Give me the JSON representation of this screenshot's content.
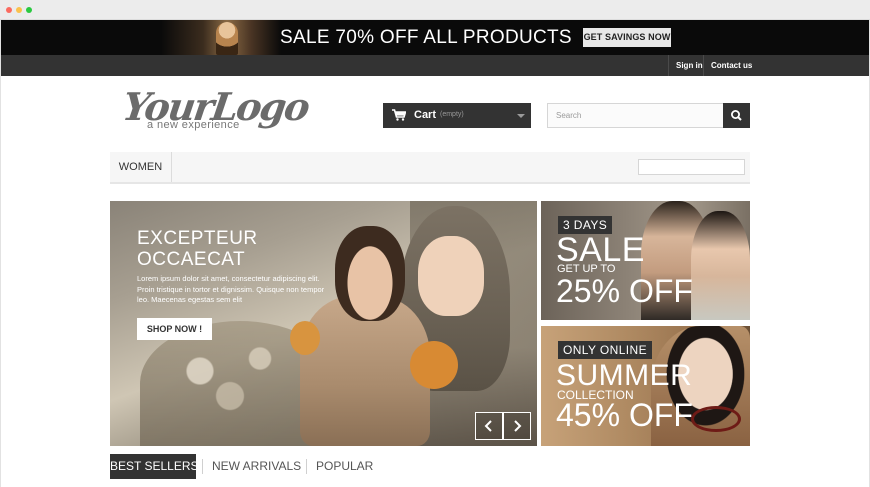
{
  "promo": {
    "headline": "SALE 70% OFF ALL PRODUCTS",
    "cta": "GET SAVINGS NOW"
  },
  "top_nav": {
    "sign_in": "Sign in",
    "contact": "Contact us"
  },
  "logo": {
    "main": "YourLogo",
    "tagline": "a new experience"
  },
  "cart": {
    "label": "Cart",
    "status": "(empty)"
  },
  "search": {
    "placeholder": "Search"
  },
  "menu": {
    "items": [
      "WOMEN"
    ]
  },
  "slider": {
    "title_line1": "EXCEPTEUR",
    "title_line2": "OCCAECAT",
    "text": "Lorem ipsum dolor sit amet, consectetur adipiscing elit. Proin tristique in tortor et dignissim. Quisque non tempor leo. Maecenas egestas sem elit",
    "button": "SHOP NOW !"
  },
  "banner_sale": {
    "badge": "3 DAYS",
    "headline": "SALE",
    "subline": "GET UP TO",
    "discount": "25% OFF"
  },
  "banner_summer": {
    "badge": "ONLY ONLINE",
    "headline": "SUMMER",
    "subline": "COLLECTION",
    "discount": "45% OFF"
  },
  "tabs": [
    "BEST SELLERS",
    "NEW ARRIVALS",
    "POPULAR"
  ],
  "colors": {
    "dark": "#333333",
    "promo_bg": "#0a0a0a",
    "menu_bg": "#f6f6f6"
  },
  "icons": [
    "cart-icon",
    "search-icon",
    "chevron-left-icon",
    "chevron-right-icon"
  ]
}
